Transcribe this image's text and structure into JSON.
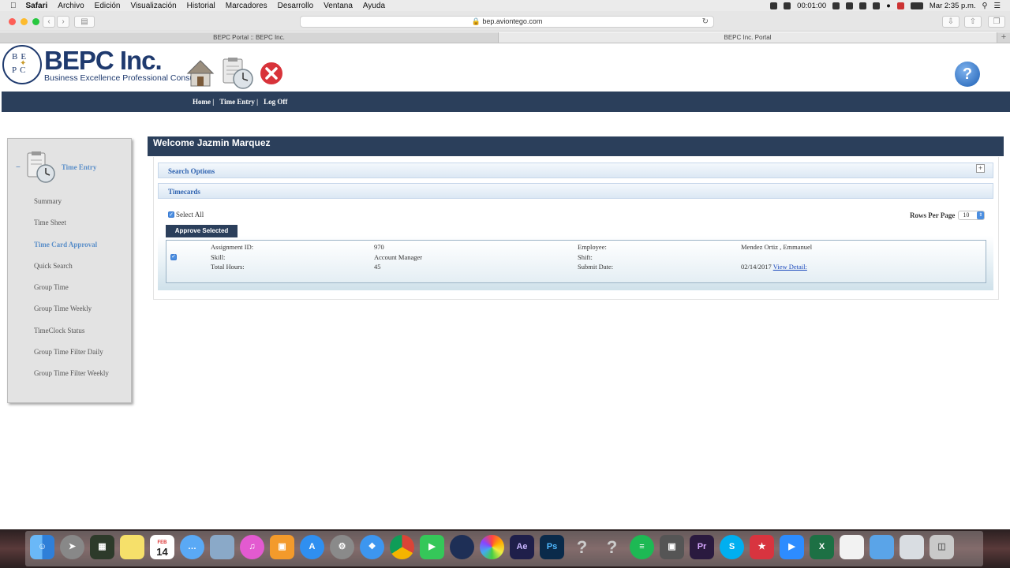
{
  "menubar": {
    "app": "Safari",
    "items": [
      "Archivo",
      "Edición",
      "Visualización",
      "Historial",
      "Marcadores",
      "Desarrollo",
      "Ventana",
      "Ayuda"
    ],
    "timer": "00:01:00",
    "clock": "Mar 2:35 p.m."
  },
  "browser": {
    "url": "bep.aviontego.com",
    "tabs": [
      "BEPC Portal :: BEPC Inc.",
      "BEPC Inc. Portal"
    ],
    "colors": {
      "close": "#fd5f57",
      "minimize": "#fdbb2e",
      "zoom": "#28c840"
    }
  },
  "header": {
    "brand": "BEPC Inc.",
    "tagline": "Business Excellence Professional Consulting",
    "seal_top": "BE",
    "seal_bottom": "PC",
    "help_symbol": "?"
  },
  "nav": {
    "home": "Home |",
    "time_entry": "Time Entry |",
    "log_off": "Log Off"
  },
  "sidebar": {
    "section": "Time Entry",
    "items": [
      {
        "label": "Summary",
        "active": false
      },
      {
        "label": "Time Sheet",
        "active": false
      },
      {
        "label": "Time Card Approval",
        "active": true
      },
      {
        "label": "Quick Search",
        "active": false
      },
      {
        "label": "Group Time",
        "active": false
      },
      {
        "label": "Group Time Weekly",
        "active": false
      },
      {
        "label": "TimeClock Status",
        "active": false
      },
      {
        "label": "Group Time Filter Daily",
        "active": false
      },
      {
        "label": "Group Time Filter Weekly",
        "active": false
      }
    ]
  },
  "main": {
    "welcome": "Welcome Jazmin Marquez",
    "search_options": "Search Options",
    "timecards": "Timecards",
    "select_all": "Select All",
    "rows_per_page_label": "Rows Per Page",
    "rows_per_page": "10",
    "approve_button": "Approve Selected",
    "record": {
      "assignment_label": "Assignment ID:",
      "assignment_value": "970",
      "employee_label": "Employee:",
      "employee_value": "Mendez Ortiz , Emmanuel",
      "skill_label": "Skill:",
      "skill_value": "Account Manager",
      "shift_label": "Shift:",
      "hours_label": "Total Hours:",
      "hours_value": "45",
      "submit_label": "Submit Date:",
      "submit_value": "02/14/2017",
      "view_detail": "View Detail:"
    }
  },
  "dock": {
    "calendar_day": "14",
    "calendar_month": "FEB",
    "ae": "Ae",
    "ps": "Ps",
    "pr": "Pr"
  }
}
